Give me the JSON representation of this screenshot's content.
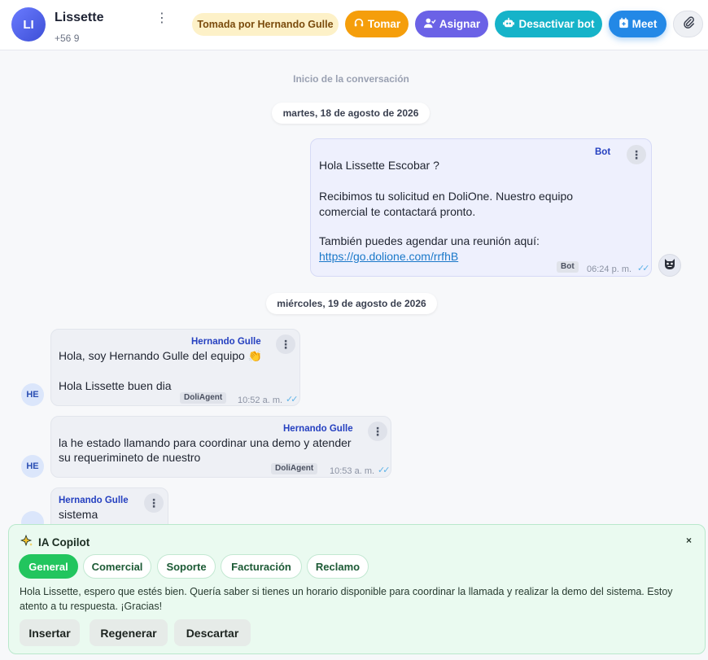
{
  "header": {
    "avatar_initials": "LI",
    "contact_name": "Lissette",
    "contact_phone": "+56 9",
    "taken_by": "Tomada por Hernando Gulle",
    "buttons": {
      "tomar": "Tomar",
      "asignar": "Asignar",
      "desactivar_bot": "Desactivar bot",
      "meet": "Meet"
    },
    "colors": {
      "tomar": "#f59e0b",
      "asignar": "#6b62e6",
      "desactivar_bot": "#16b3c9",
      "meet": "#2388e6"
    }
  },
  "conversation": {
    "start_label": "Inicio de la conversación",
    "dates": [
      "martes, 18 de agosto de 2026",
      "miércoles, 19 de agosto de 2026"
    ],
    "messages": [
      {
        "sender": "Bot",
        "lines": [
          "Hola Lissette Escobar ?",
          "Recibimos tu solicitud en DoliOne. Nuestro equipo",
          "comercial te contactará pronto.",
          "También puedes agendar una reunión aquí:"
        ],
        "link": "https://go.dolione.com/rrfhB",
        "tag": "Bot",
        "time": "06:24 p. m."
      },
      {
        "sender": "Hernando Gulle",
        "lines": [
          "Hola, soy Hernando Gulle del equipo 👏",
          "Hola Lissette buen dia"
        ],
        "tag": "DoliAgent",
        "time": "10:52 a. m.",
        "avatar": "HE"
      },
      {
        "sender": "Hernando Gulle",
        "lines": [
          "la he estado llamando para coordinar una demo y atender",
          "su requerimineto de nuestro"
        ],
        "tag": "DoliAgent",
        "time": "10:53 a. m.",
        "avatar": "HE"
      },
      {
        "sender": "Hernando Gulle",
        "lines": [
          "sistema"
        ]
      }
    ]
  },
  "copilot": {
    "title": "IA Copilot",
    "close": "×",
    "tabs": [
      "General",
      "Comercial",
      "Soporte",
      "Facturación",
      "Reclamo"
    ],
    "active_tab": "General",
    "suggestion": "Hola Lissette, espero que estés bien. Quería saber si tienes un horario disponible para coordinar la llamada y realizar la demo del sistema. Estoy atento a tu respuesta. ¡Gracias!",
    "actions": [
      "Insertar",
      "Regenerar",
      "Descartar"
    ]
  }
}
